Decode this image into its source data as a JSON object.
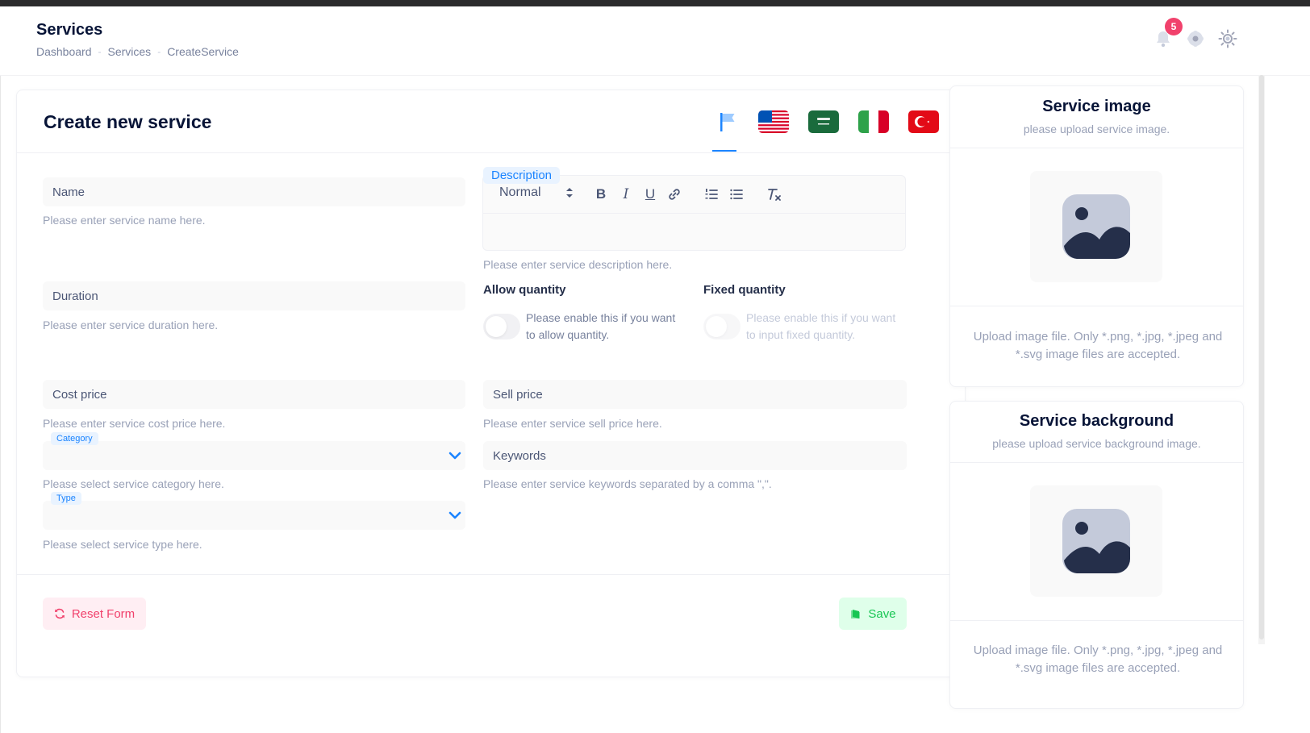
{
  "header": {
    "title": "Services",
    "breadcrumbs": [
      "Dashboard",
      "Services",
      "CreateService"
    ],
    "notification_count": "5",
    "icons": [
      "bell-icon",
      "gear-icon",
      "sun-icon"
    ]
  },
  "form": {
    "title": "Create new service",
    "languages": [
      "default-flag",
      "us-flag",
      "sa-flag",
      "it-flag",
      "tr-flag"
    ],
    "name": {
      "placeholder": "Name",
      "hint": "Please enter service name here."
    },
    "duration": {
      "placeholder": "Duration",
      "hint": "Please enter service duration here."
    },
    "cost_price": {
      "placeholder": "Cost price",
      "hint": "Please enter service cost price here."
    },
    "category": {
      "label": "Category",
      "hint": "Please select service category here."
    },
    "type": {
      "label": "Type",
      "hint": "Please select service type here."
    },
    "description": {
      "label": "Description",
      "format": "Normal",
      "hint": "Please enter service description here."
    },
    "allow_quantity": {
      "label": "Allow quantity",
      "text": "Please enable this if you want to allow quantity."
    },
    "fixed_quantity": {
      "label": "Fixed quantity",
      "text": "Please enable this if you want to input fixed quantity."
    },
    "sell_price": {
      "placeholder": "Sell price",
      "hint": "Please enter service sell price here."
    },
    "keywords": {
      "placeholder": "Keywords",
      "hint": "Please enter service keywords separated by a comma \",\"."
    },
    "reset_label": "Reset Form",
    "save_label": "Save"
  },
  "service_image": {
    "title": "Service image",
    "subtitle": "please upload service image.",
    "note": "Upload image file. Only *.png, *.jpg, *.jpeg and *.svg image files are accepted."
  },
  "service_background": {
    "title": "Service background",
    "subtitle": "please upload service background image.",
    "note": "Upload image file. Only *.png, *.jpg, *.jpeg and *.svg image files are accepted."
  },
  "colors": {
    "primary": "#1b84ff",
    "danger": "#f1416c",
    "success": "#17c653"
  }
}
